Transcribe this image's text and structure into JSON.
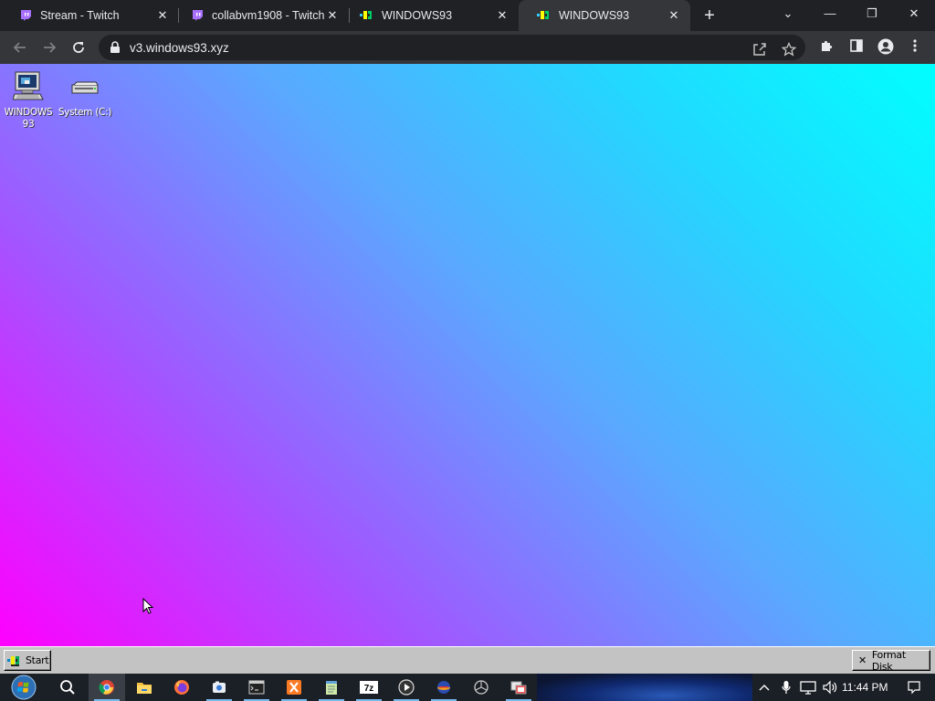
{
  "browser": {
    "tabs": [
      {
        "title": "Stream - Twitch",
        "favicon": "twitch-icon",
        "active": false
      },
      {
        "title": "collabvm1908 - Twitch",
        "favicon": "twitch-icon",
        "active": false
      },
      {
        "title": "WINDOWS93",
        "favicon": "windows93-icon",
        "active": false
      },
      {
        "title": "WINDOWS93",
        "favicon": "windows93-icon",
        "active": true
      }
    ],
    "close_glyph": "✕",
    "new_tab_glyph": "+",
    "window_controls": {
      "dropdown": "⌄",
      "minimize": "—",
      "restore": "❐",
      "close": "✕"
    },
    "address_bar": {
      "url": "v3.windows93.xyz"
    },
    "colors": {
      "tabstrip": "#202124",
      "toolbar": "#35363a",
      "omnibox": "#202124"
    }
  },
  "desktop": {
    "icons": [
      {
        "label": "WINDOWS 93",
        "icon": "computer-icon"
      },
      {
        "label": "System (C:)",
        "icon": "drive-icon"
      }
    ]
  },
  "w93_taskbar": {
    "start_label": "Start",
    "format_disk_label": "Format Disk",
    "format_disk_glyph": "✕"
  },
  "win_taskbar": {
    "apps": [
      "start-orb-icon",
      "search-icon",
      "chrome-icon",
      "file-explorer-icon",
      "firefox-icon",
      "snipping-tool-icon",
      "cmd-icon",
      "xampp-icon",
      "notepad-icon",
      "7zip-icon",
      "media-player-icon",
      "app-icon",
      "settings-icon",
      "remote-desktop-icon"
    ],
    "tray": [
      "chevron-up-icon",
      "microphone-icon",
      "network-icon",
      "volume-icon"
    ],
    "clock": "11:44 PM",
    "notification_icon": "notification-icon"
  }
}
